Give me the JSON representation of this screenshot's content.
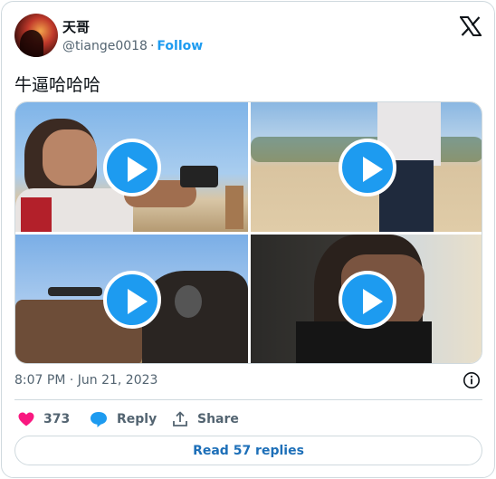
{
  "author": {
    "display_name": "天哥",
    "handle": "@tiange0018",
    "separator": "·",
    "follow_label": "Follow"
  },
  "tweet": {
    "text": "牛逼哈哈哈"
  },
  "media": {
    "videos": [
      {
        "icon": "play-icon"
      },
      {
        "icon": "play-icon"
      },
      {
        "icon": "play-icon"
      },
      {
        "icon": "play-icon"
      }
    ]
  },
  "meta": {
    "timestamp": "8:07 PM · Jun 21, 2023"
  },
  "actions": {
    "like_count": "373",
    "reply_label": "Reply",
    "share_label": "Share"
  },
  "read_replies_label": "Read 57 replies",
  "colors": {
    "accent": "#1d9bf0",
    "like": "#f91880",
    "reply_icon": "#1d9bf0",
    "secondary_text": "#536471",
    "border": "#cfd9de"
  }
}
